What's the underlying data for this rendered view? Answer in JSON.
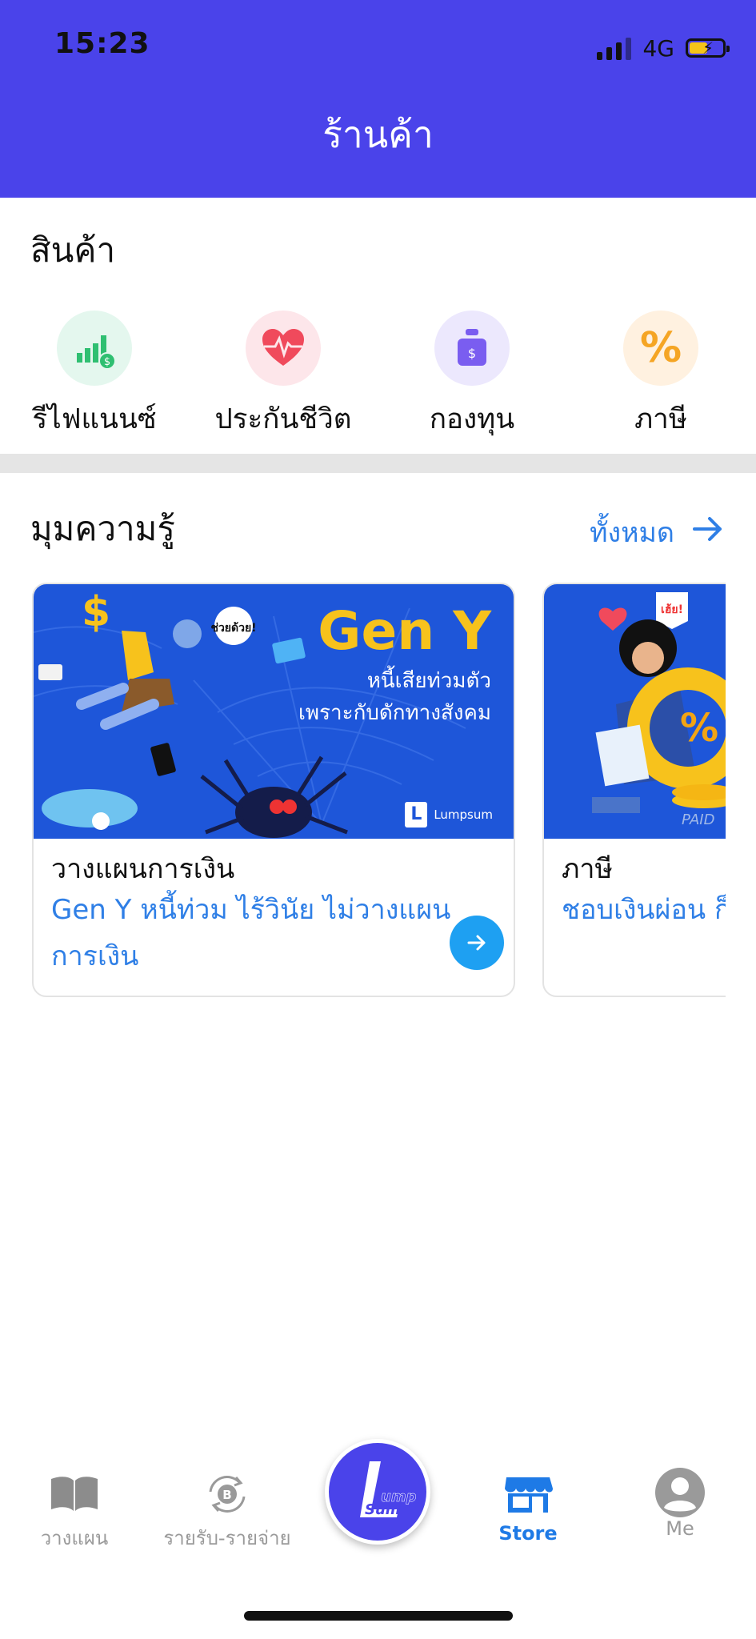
{
  "status_bar": {
    "time": "15:23",
    "network": "4G"
  },
  "header": {
    "title": "ร้านค้า"
  },
  "products_section": {
    "title": "สินค้า",
    "items": [
      {
        "label": "รีไฟแนนซ์",
        "icon": "chart-money-icon",
        "bg": "#e4f7ee",
        "color": "#2fbf71"
      },
      {
        "label": "ประกันชีวิต",
        "icon": "heart-pulse-icon",
        "bg": "#fde6ea",
        "color": "#f04a5c"
      },
      {
        "label": "กองทุน",
        "icon": "money-bag-icon",
        "bg": "#ece8fd",
        "color": "#7a5df0"
      },
      {
        "label": "ภาษี",
        "icon": "percent-icon",
        "bg": "#fff1e0",
        "color": "#f5a524"
      }
    ]
  },
  "knowledge_section": {
    "title": "มุมความรู้",
    "see_all": "ทั้งหมด",
    "articles": [
      {
        "category": "วางแผนการเงิน",
        "title": "Gen Y หนี้ท่วม ไร้วินัย ไม่วางแผนการเงิน",
        "image_heading": "Gen Y",
        "image_sub1": "หนี้เสียท่วมตัว",
        "image_sub2": "เพราะกับดักทางสังคม",
        "bubble": "ช่วยด้วย!",
        "brand": "Lumpsum"
      },
      {
        "category": "ภาษี",
        "title": "ชอบเงินผ่อน ก็ทำได้นะ...รู้ยัง",
        "bubble": "เฮ้ย!",
        "badge": "PAID"
      }
    ]
  },
  "tab_bar": {
    "items": [
      {
        "label": "วางแผน",
        "icon": "book-icon",
        "active": false
      },
      {
        "label": "รายรับ-รายจ่าย",
        "icon": "baht-cycle-icon",
        "active": false
      },
      {
        "label": "Store",
        "icon": "store-icon",
        "active": true
      },
      {
        "label": "Me",
        "icon": "user-icon",
        "active": false
      }
    ],
    "center_logo": "Lump Sum"
  },
  "colors": {
    "brand": "#4a43ea",
    "accent": "#2f7fe6",
    "link": "#1e7ae6"
  }
}
